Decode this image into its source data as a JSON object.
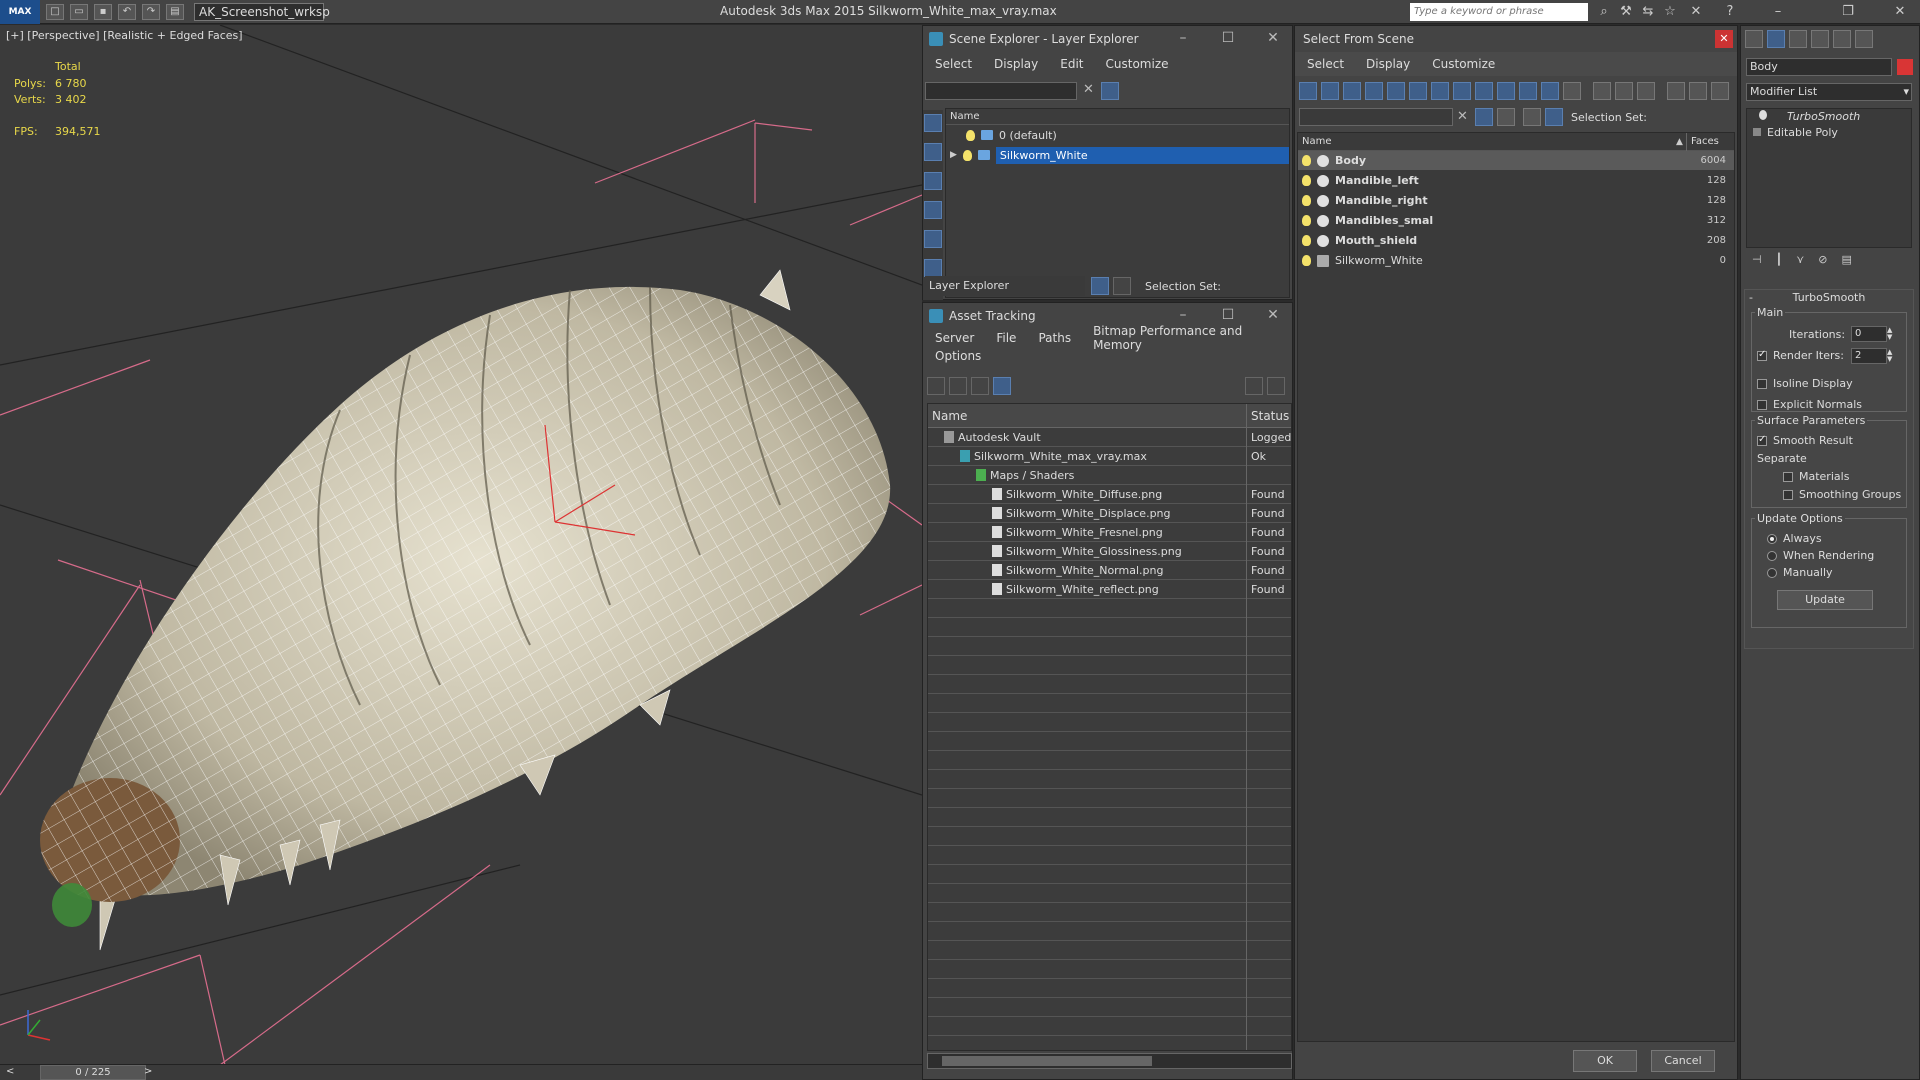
{
  "titlebar": {
    "logo": "MAX",
    "workspace": "AK_Screenshot_wrksp",
    "app_title": "Autodesk 3ds Max  2015     Silkworm_White_max_vray.max",
    "search_placeholder": "Type a keyword or phrase"
  },
  "viewport": {
    "label": "[+] [Perspective] [Realistic + Edged Faces]",
    "stats": {
      "total_label": "Total",
      "polys_label": "Polys:",
      "polys_value": "6 780",
      "verts_label": "Verts:",
      "verts_value": "3 402",
      "fps_label": "FPS:",
      "fps_value": "394,571"
    }
  },
  "timeline": {
    "frame": "0 / 225",
    "prev": "<",
    "next": ">"
  },
  "scene_explorer": {
    "title": "Scene Explorer - Layer Explorer",
    "menu": [
      "Select",
      "Display",
      "Edit",
      "Customize"
    ],
    "column_name": "Name",
    "layers": [
      {
        "label": "0 (default)",
        "selected": false
      },
      {
        "label": "Silkworm_White",
        "selected": true
      }
    ],
    "footer_dropdown": "Layer Explorer",
    "selection_set_label": "Selection Set:"
  },
  "asset_tracking": {
    "title": "Asset Tracking",
    "menu_row1": [
      "Server",
      "File",
      "Paths",
      "Bitmap Performance and Memory"
    ],
    "menu_row2": [
      "Options"
    ],
    "col_name": "Name",
    "col_status": "Status",
    "rows": [
      {
        "name": "Autodesk Vault",
        "status": "Logged",
        "indent": 1
      },
      {
        "name": "Silkworm_White_max_vray.max",
        "status": "Ok",
        "indent": 2
      },
      {
        "name": "Maps / Shaders",
        "status": "",
        "indent": 3
      },
      {
        "name": "Silkworm_White_Diffuse.png",
        "status": "Found",
        "indent": 4
      },
      {
        "name": "Silkworm_White_Displace.png",
        "status": "Found",
        "indent": 4
      },
      {
        "name": "Silkworm_White_Fresnel.png",
        "status": "Found",
        "indent": 4
      },
      {
        "name": "Silkworm_White_Glossiness.png",
        "status": "Found",
        "indent": 4
      },
      {
        "name": "Silkworm_White_Normal.png",
        "status": "Found",
        "indent": 4
      },
      {
        "name": "Silkworm_White_reflect.png",
        "status": "Found",
        "indent": 4
      }
    ]
  },
  "select_from_scene": {
    "title": "Select From Scene",
    "menu": [
      "Select",
      "Display",
      "Customize"
    ],
    "selection_set_label": "Selection Set:",
    "col_name": "Name",
    "col_faces": "Faces",
    "objects": [
      {
        "name": "Body",
        "faces": "6004",
        "selected": true,
        "bold": true
      },
      {
        "name": "Mandible_left",
        "faces": "128",
        "selected": false,
        "bold": true
      },
      {
        "name": "Mandible_right",
        "faces": "128",
        "selected": false,
        "bold": true
      },
      {
        "name": "Mandibles_smal",
        "faces": "312",
        "selected": false,
        "bold": true
      },
      {
        "name": "Mouth_shield",
        "faces": "208",
        "selected": false,
        "bold": true
      },
      {
        "name": "Silkworm_White",
        "faces": "0",
        "selected": false,
        "bold": false
      }
    ],
    "ok": "OK",
    "cancel": "Cancel"
  },
  "command_panel": {
    "object_name": "Body",
    "modifier_list": "Modifier List",
    "stack": [
      "TurboSmooth",
      "Editable Poly"
    ],
    "rollout_title": "TurboSmooth",
    "main_label": "Main",
    "iterations_label": "Iterations:",
    "iterations_value": "0",
    "render_iters_label": "Render Iters:",
    "render_iters_value": "2",
    "isoline": "Isoline Display",
    "explicit_normals": "Explicit Normals",
    "surface_params": "Surface Parameters",
    "smooth_result": "Smooth Result",
    "separate": "Separate",
    "materials": "Materials",
    "smoothing_groups": "Smoothing Groups",
    "update_options": "Update Options",
    "always": "Always",
    "when_rendering": "When Rendering",
    "manually": "Manually",
    "update_button": "Update"
  }
}
